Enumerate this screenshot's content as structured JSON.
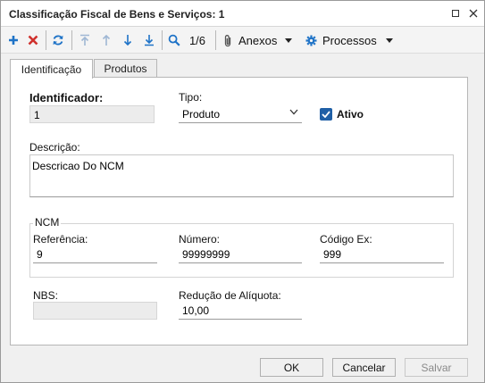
{
  "window": {
    "title": "Classificação Fiscal de Bens e Serviços: 1"
  },
  "toolbar": {
    "record_position": "1/6",
    "anexos_label": "Anexos",
    "processos_label": "Processos"
  },
  "tabs": [
    {
      "label": "Identificação",
      "active": true
    },
    {
      "label": "Produtos",
      "active": false
    }
  ],
  "form": {
    "identificador_label": "Identificador:",
    "identificador_value": "1",
    "tipo_label": "Tipo:",
    "tipo_value": "Produto",
    "ativo_label": "Ativo",
    "ativo_checked": true,
    "descricao_label": "Descrição:",
    "descricao_value": "Descricao Do NCM",
    "ncm_group_label": "NCM",
    "referencia_label": "Referência:",
    "referencia_value": "9",
    "numero_label": "Número:",
    "numero_value": "99999999",
    "codigo_ex_label": "Código Ex:",
    "codigo_ex_value": "999",
    "nbs_label": "NBS:",
    "nbs_value": "",
    "reducao_label": "Redução de Alíquota:",
    "reducao_value": "10,00"
  },
  "footer": {
    "ok_label": "OK",
    "cancelar_label": "Cancelar",
    "salvar_label": "Salvar"
  },
  "colors": {
    "accent_blue": "#1f73c7",
    "delete_red": "#d0312d",
    "checkbox_blue": "#1f5fa6"
  }
}
